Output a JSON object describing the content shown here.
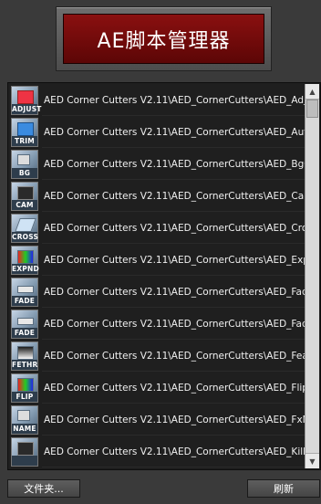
{
  "header": {
    "title": "AE脚本管理器"
  },
  "list": {
    "items": [
      {
        "caption": "ADJUST",
        "text": "AED Corner Cutters V2.11\\AED_CornerCutters\\AED_Adjust"
      },
      {
        "caption": "TRIM",
        "text": "AED Corner Cutters V2.11\\AED_CornerCutters\\AED_AutoTr"
      },
      {
        "caption": "BG",
        "text": "AED Corner Cutters V2.11\\AED_CornerCutters\\AED_BgColo"
      },
      {
        "caption": "CAM",
        "text": "AED Corner Cutters V2.11\\AED_CornerCutters\\AED_Camer"
      },
      {
        "caption": "CROSS",
        "text": "AED Corner Cutters V2.11\\AED_CornerCutters\\AED_CrossB"
      },
      {
        "caption": "EXPND",
        "text": "AED Corner Cutters V2.11\\AED_CornerCutters\\AED_Expan"
      },
      {
        "caption": "FADE",
        "text": "AED Corner Cutters V2.11\\AED_CornerCutters\\AED_FadeIn"
      },
      {
        "caption": "FADE",
        "text": "AED Corner Cutters V2.11\\AED_CornerCutters\\AED_FadeC"
      },
      {
        "caption": "FETHR",
        "text": "AED Corner Cutters V2.11\\AED_CornerCutters\\AED_Feathe"
      },
      {
        "caption": "FLIP",
        "text": "AED Corner Cutters V2.11\\AED_CornerCutters\\AED_FlipCol"
      },
      {
        "caption": "NAME",
        "text": "AED Corner Cutters V2.11\\AED_CornerCutters\\AED_FxNam"
      },
      {
        "caption": "",
        "text": "AED Corner Cutters V2.11\\AED_CornerCutters\\AED_KillDea"
      }
    ]
  },
  "footer": {
    "folder_label": "文件夹...",
    "refresh_label": "刷新"
  }
}
